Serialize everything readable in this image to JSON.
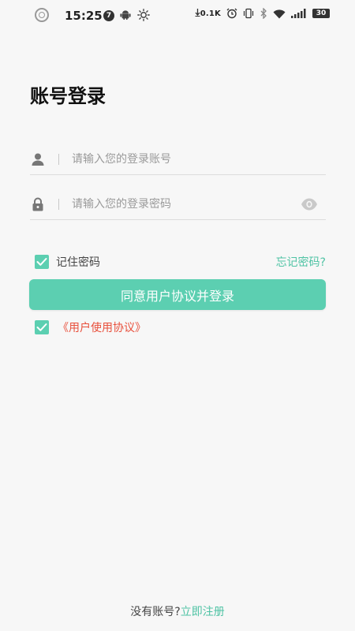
{
  "status_bar": {
    "time": "15:25",
    "notification_count": "7",
    "network_speed": "0.1K",
    "battery": "30"
  },
  "page": {
    "title": "账号登录"
  },
  "form": {
    "account_placeholder": "请输入您的登录账号",
    "account_value": "",
    "password_placeholder": "请输入您的登录密码",
    "password_value": "",
    "remember_label": "记住密码",
    "remember_checked": true,
    "forgot_label": "忘记密码?",
    "login_button": "同意用户协议并登录",
    "agreement_label": "《用户使用协议》",
    "agreement_checked": true
  },
  "footer": {
    "prompt": "没有账号?",
    "register_link": "立即注册"
  },
  "colors": {
    "accent": "#5ccfb1",
    "link_green": "#4fc3a4",
    "agreement_red": "#e8503c",
    "background": "#f7f7f7"
  },
  "icons": {
    "account": "user-icon",
    "password": "lock-icon",
    "visibility": "eye-icon"
  }
}
